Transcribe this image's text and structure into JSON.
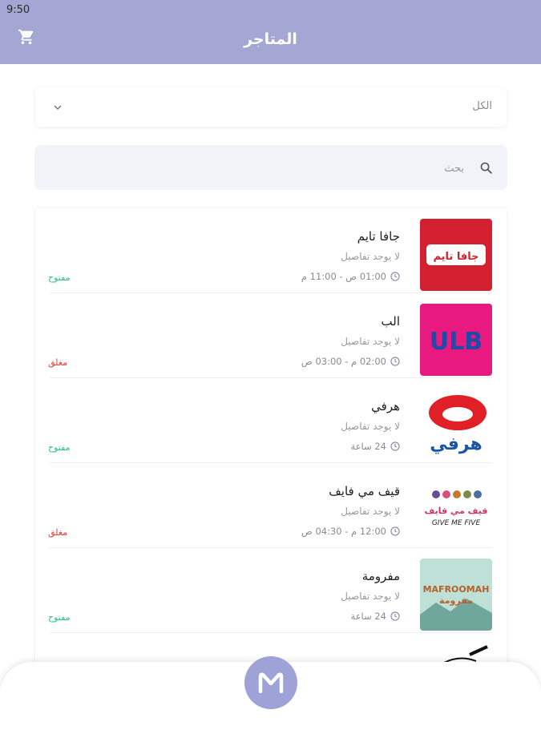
{
  "status_bar": {
    "time": "9:50"
  },
  "header": {
    "title": "المتاجر",
    "cart_icon": "cart-icon",
    "color": "#a4a6d3"
  },
  "filter": {
    "selected": "الكل"
  },
  "search": {
    "placeholder": "بحث"
  },
  "stores": [
    {
      "name": "جافا تايم",
      "details": "لا يوجد تفاصيل",
      "hours": "01:00 ص - 11:00 م",
      "status": "مفتوح",
      "open": true
    },
    {
      "name": "الب",
      "details": "لا يوجد تفاصيل",
      "hours": "02:00 م - 03:00 ص",
      "status": "مغلق",
      "open": false
    },
    {
      "name": "هرفي",
      "details": "لا يوجد تفاصيل",
      "hours": "24 ساعة",
      "status": "مفتوح",
      "open": true
    },
    {
      "name": "قيف مي فايف",
      "details": "لا يوجد تفاصيل",
      "hours": "12:00 م - 04:30 ص",
      "status": "مغلق",
      "open": false
    },
    {
      "name": "مفرومة",
      "details": "لا يوجد تفاصيل",
      "hours": "24 ساعة",
      "status": "مفتوح",
      "open": true
    }
  ],
  "logos": {
    "java_time": {
      "text": "جافا تايم"
    },
    "ulb": {
      "text": "ULB"
    },
    "herfy": {
      "text": "هرفي"
    },
    "give_me_five": {
      "ar": "قيف مي فايف",
      "en": "GIVE ME FIVE"
    },
    "mafroomah": {
      "en": "MAFROOMAH",
      "ar": "مفرومة"
    }
  },
  "colors": {
    "open": "#2ec27e",
    "closed": "#e53935",
    "accent": "#9ea2d6"
  }
}
